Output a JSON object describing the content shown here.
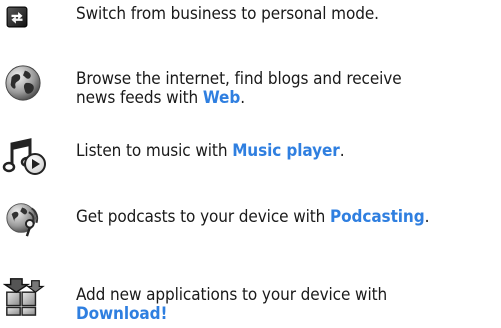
{
  "items": [
    {
      "icon": "mode-switch-icon",
      "parts": [
        "Switch from business to personal mode."
      ]
    },
    {
      "icon": "globe-icon",
      "parts": [
        "Browse the internet, find blogs and receive",
        "news feeds with ",
        "Web",
        "."
      ]
    },
    {
      "icon": "music-note-play-icon",
      "parts": [
        "Listen to music with ",
        "Music player",
        "."
      ]
    },
    {
      "icon": "podcast-icon",
      "parts": [
        "Get podcasts to your device with ",
        "Podcasting",
        "."
      ]
    },
    {
      "icon": "download-apps-icon",
      "parts": [
        "Add new applications to your device with",
        "Download!"
      ]
    }
  ],
  "colors": {
    "link": "#2f7fe0",
    "text": "#1a1a1a"
  }
}
